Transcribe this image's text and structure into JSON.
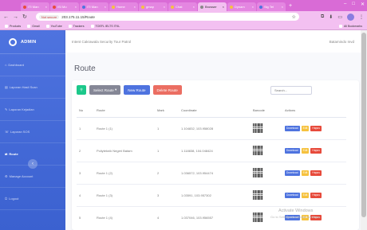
{
  "browser": {
    "tabs": [
      {
        "label": "ITI Man",
        "color": "#e74a3b",
        "active": false
      },
      {
        "label": "ISI Mo",
        "color": "#e74a3b",
        "active": false
      },
      {
        "label": "ITI Man",
        "color": "#4e73df",
        "active": false
      },
      {
        "label": "Home",
        "color": "#f6c23e",
        "active": false
      },
      {
        "label": "gmap",
        "color": "#f6c23e",
        "active": false
      },
      {
        "label": "Chat",
        "color": "#f6c23e",
        "active": false
      },
      {
        "label": "Browser",
        "color": "#888888",
        "active": true
      },
      {
        "label": "Dynam",
        "color": "#f6c23e",
        "active": false
      },
      {
        "label": "Sig Tel",
        "color": "#4e73df",
        "active": false
      }
    ],
    "new_tab": "+",
    "address": {
      "security": "Not secure",
      "url": "203.175.11.15/Route"
    },
    "bookmarks": [
      "Products",
      "Gmail",
      "YouTube",
      "Trackers",
      "TOEFL IELTS ITKL"
    ],
    "bookmarks_all": "All Bookmarks"
  },
  "sidebar": {
    "brand": "ADMIN",
    "items": [
      {
        "label": "Dashboard",
        "active": false
      },
      {
        "label": "Laporan Hasil Scan",
        "active": false
      },
      {
        "label": "Laporan Kejadian",
        "active": false
      },
      {
        "label": "Laporan SOS",
        "active": false
      },
      {
        "label": "Route",
        "active": true
      },
      {
        "label": "Manage Account",
        "active": false
      },
      {
        "label": "Logout",
        "active": false
      }
    ],
    "toggle": "‹"
  },
  "topbar": {
    "title": "Intent Cakrawala Security Tour Patrol",
    "user": "Batamindo Invd"
  },
  "main": {
    "page_title": "Route",
    "toolbar": {
      "select_route": "Select Route",
      "new_route": "New Route",
      "delete_route": "Delete Route"
    },
    "search_placeholder": "Search...",
    "table": {
      "headers": [
        "No",
        "Route",
        "Mark",
        "Coordinate",
        "Barcode",
        "Actions"
      ],
      "rows": [
        {
          "no": "1",
          "route": "Route 1 (1)",
          "mark": "1",
          "coordinate": "1.104832, 103.958028"
        },
        {
          "no": "2",
          "route": "Poliyteknik Negeri Batam",
          "mark": "1",
          "coordinate": "1.118838, 104.048424"
        },
        {
          "no": "3",
          "route": "Route 1 (2)",
          "mark": "2",
          "coordinate": "1.036572, 103.954474"
        },
        {
          "no": "4",
          "route": "Route 1 (3)",
          "mark": "3",
          "coordinate": "1.03591, 103.957302"
        },
        {
          "no": "5",
          "route": "Route 1 (4)",
          "mark": "4",
          "coordinate": "1.037046, 103.956557"
        }
      ],
      "actions": {
        "download": "Download",
        "edit": "Edit",
        "delete": "Hapus"
      }
    }
  },
  "watermark": {
    "title": "Activate Windows",
    "subtitle": "Go to Settings to activate Windows."
  }
}
